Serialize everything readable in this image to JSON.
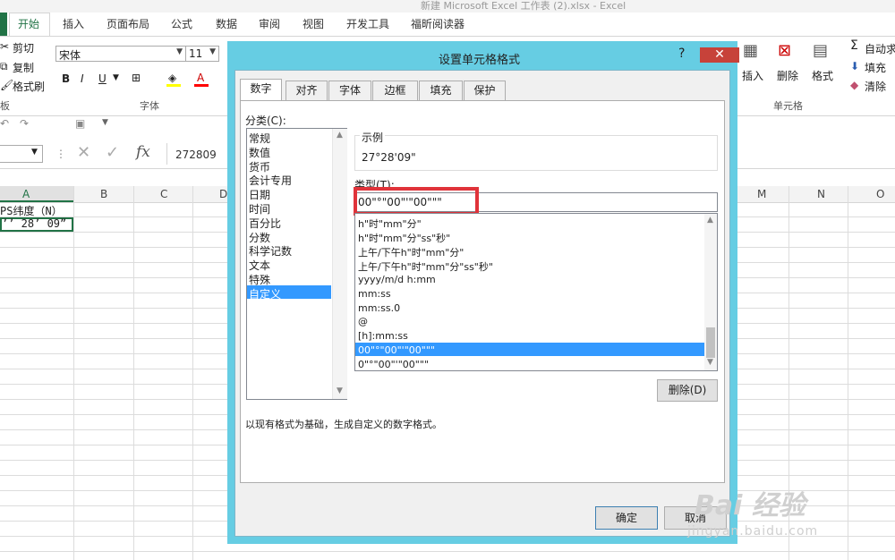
{
  "window": {
    "title": "新建 Microsoft Excel 工作表 (2).xlsx - Excel"
  },
  "ribbon": {
    "tabs": [
      "开始",
      "插入",
      "页面布局",
      "公式",
      "数据",
      "审阅",
      "视图",
      "开发工具",
      "福昕阅读器"
    ],
    "clipboard": {
      "cut": "剪切",
      "copy": "复制",
      "format_painter": "格式刷",
      "group": "板"
    },
    "font": {
      "name": "宋体",
      "size": "11",
      "bold": "B",
      "italic": "I",
      "underline": "U",
      "group": "字体"
    },
    "cells": {
      "insert": "插入",
      "delete": "删除",
      "format": "格式",
      "group": "单元格"
    },
    "editing": {
      "autosum": "自动求",
      "fill": "填充",
      "clear": "清除"
    }
  },
  "formula_bar": {
    "fx": "fx",
    "value": "272809"
  },
  "grid": {
    "columns": [
      "A",
      "B",
      "C",
      "D",
      "M",
      "N",
      "O"
    ],
    "a1": "PS纬度（N）",
    "a2": "’’  28’ 09”"
  },
  "dialog": {
    "title": "设置单元格格式",
    "help": "?",
    "tabs": [
      "数字",
      "对齐",
      "字体",
      "边框",
      "填充",
      "保护"
    ],
    "category_label": "分类(C):",
    "categories": [
      "常规",
      "数值",
      "货币",
      "会计专用",
      "日期",
      "时间",
      "百分比",
      "分数",
      "科学记数",
      "文本",
      "特殊",
      "自定义"
    ],
    "sample_label": "示例",
    "sample_value": "27°28'09\"",
    "type_label": "类型(T):",
    "type_value": "00\"°\"00\"'\"00\"\"\"",
    "formats": [
      "h\"时\"mm\"分\"",
      "h\"时\"mm\"分\"ss\"秒\"",
      "上午/下午h\"时\"mm\"分\"",
      "上午/下午h\"时\"mm\"分\"ss\"秒\"",
      "yyyy/m/d h:mm",
      "mm:ss",
      "mm:ss.0",
      "@",
      "[h]:mm:ss",
      "00\"°\"00\"'\"00\"\"\"",
      "0\"°\"00\"'\"00\"\"\""
    ],
    "delete_button": "删除(D)",
    "hint": "以现有格式为基础，生成自定义的数字格式。",
    "ok": "确定",
    "cancel": "取消"
  },
  "watermark": {
    "main": "Bai 经验",
    "sub": "jingyan.baidu.com"
  },
  "colors": {
    "excel_green": "#217346",
    "dialog_frame": "#66cde3",
    "close_red": "#c7423a",
    "highlight": "#e0333a",
    "selection": "#3399ff"
  }
}
